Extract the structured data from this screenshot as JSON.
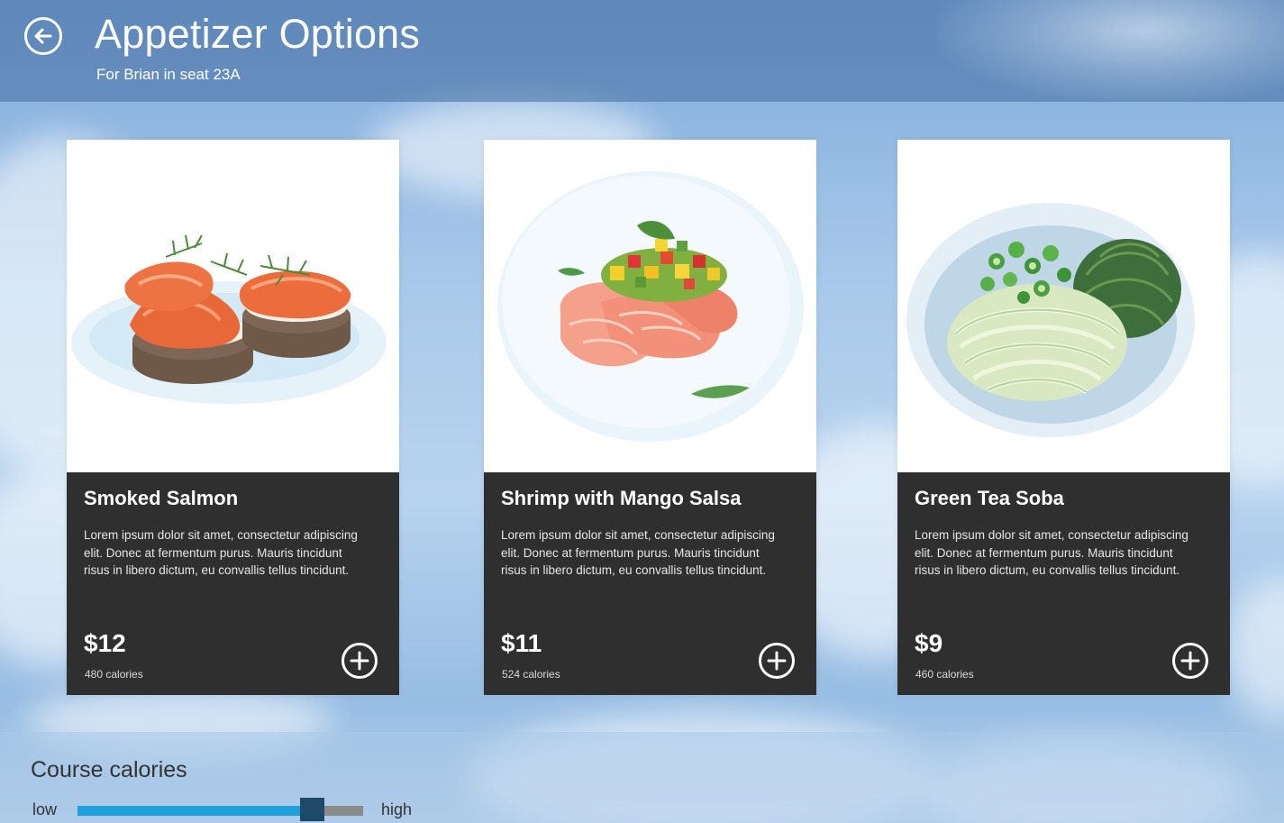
{
  "header": {
    "title": "Appetizer Options",
    "subtitle": "For Brian in seat 23A"
  },
  "icons": {
    "back": "back-arrow-icon",
    "add": "add-circle-icon"
  },
  "colors": {
    "card_info_bg": "#2f2f2f",
    "slider_fill": "#1fa0dc",
    "slider_thumb": "#1e4a6a",
    "slider_track": "#8a8a8a"
  },
  "items": [
    {
      "name": "Smoked Salmon",
      "description": "Lorem ipsum dolor sit amet, consectetur adipiscing elit. Donec at fermentum purus. Mauris tincidunt risus in libero dictum, eu convallis tellus tincidunt.",
      "price": "$12",
      "calories": "480 calories",
      "image": "smoked-salmon-illustration"
    },
    {
      "name": "Shrimp with Mango Salsa",
      "description": "Lorem ipsum dolor sit amet, consectetur adipiscing elit. Donec at fermentum purus. Mauris tincidunt risus in libero dictum, eu convallis tellus tincidunt.",
      "price": "$11",
      "calories": "524 calories",
      "image": "shrimp-mango-salsa-illustration"
    },
    {
      "name": "Green Tea Soba",
      "description": "Lorem ipsum dolor sit amet, consectetur adipiscing elit. Donec at fermentum purus. Mauris tincidunt risus in libero dictum, eu convallis tellus tincidunt.",
      "price": "$9",
      "calories": "460 calories",
      "image": "green-tea-soba-illustration"
    }
  ],
  "calorie_slider": {
    "label": "Course calories",
    "low_label": "low",
    "high_label": "high",
    "value_fraction": 0.82
  }
}
